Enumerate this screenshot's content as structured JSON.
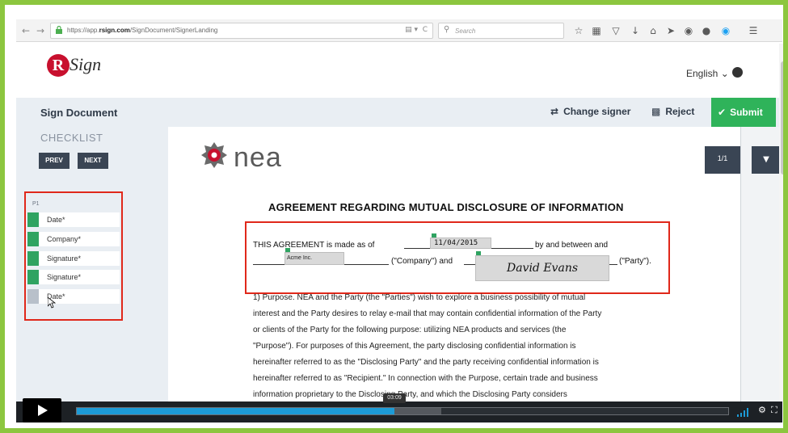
{
  "browser": {
    "url_prefix": "https://app.",
    "url_domain": "rsign.com",
    "url_path": "/SignDocument/SignerLanding",
    "search_placeholder": "Search",
    "back_icon": "back-arrow-icon",
    "forward_icon": "forward-arrow-icon"
  },
  "header": {
    "logo_letter": "R",
    "logo_text": "Sign",
    "language": "English"
  },
  "signbar": {
    "title": "Sign Document",
    "change_signer": "Change signer",
    "reject": "Reject",
    "submit": "Submit"
  },
  "checklist": {
    "title": "CHECKLIST",
    "prev": "PREV",
    "next": "NEXT",
    "page_label": "P1",
    "items": [
      {
        "label": "Date*",
        "done": true
      },
      {
        "label": "Company*",
        "done": true
      },
      {
        "label": "Signature*",
        "done": true
      },
      {
        "label": "Signature*",
        "done": true
      },
      {
        "label": "Date*",
        "done": false
      }
    ]
  },
  "document": {
    "company_logo_text": "nea",
    "page_indicator": "1/1",
    "title": "AGREEMENT REGARDING MUTUAL DISCLOSURE OF INFORMATION",
    "line1_a": "THIS AGREEMENT is made as of",
    "date_value": "11/04/2015",
    "line1_b": "by and between and",
    "company_value": "Acme Inc.",
    "line2_a": "(\"Company\") and",
    "signature_value": "David Evans",
    "line2_b": "(\"Party\").",
    "body_lines": [
      "1) Purpose.  NEA and the Party (the \"Parties\") wish to explore a business possibility of mutual",
      "interest and the Party desires to relay e-mail that may contain confidential information of the Party",
      "or clients of the Party for the following purpose: utilizing NEA products and services (the",
      "\"Purpose\").  For purposes of this Agreement, the party disclosing confidential information is",
      "hereinafter referred to as the \"Disclosing Party\" and the party receiving confidential information is",
      "hereinafter referred to as \"Recipient.\"  In connection with the Purpose, certain trade and business",
      "information proprietary to the Disclosing Party, and which the Disclosing Party considers"
    ]
  },
  "video": {
    "time": "03:09",
    "played_fraction": 0.488,
    "buffered_fraction": 0.56
  },
  "colors": {
    "frame_green": "#8cc63f",
    "highlight_red": "#e0281a",
    "submit_green": "#2fb35a",
    "check_green": "#2fa361",
    "dark_button": "#3a4554",
    "progress_blue": "#1d9bd6"
  }
}
